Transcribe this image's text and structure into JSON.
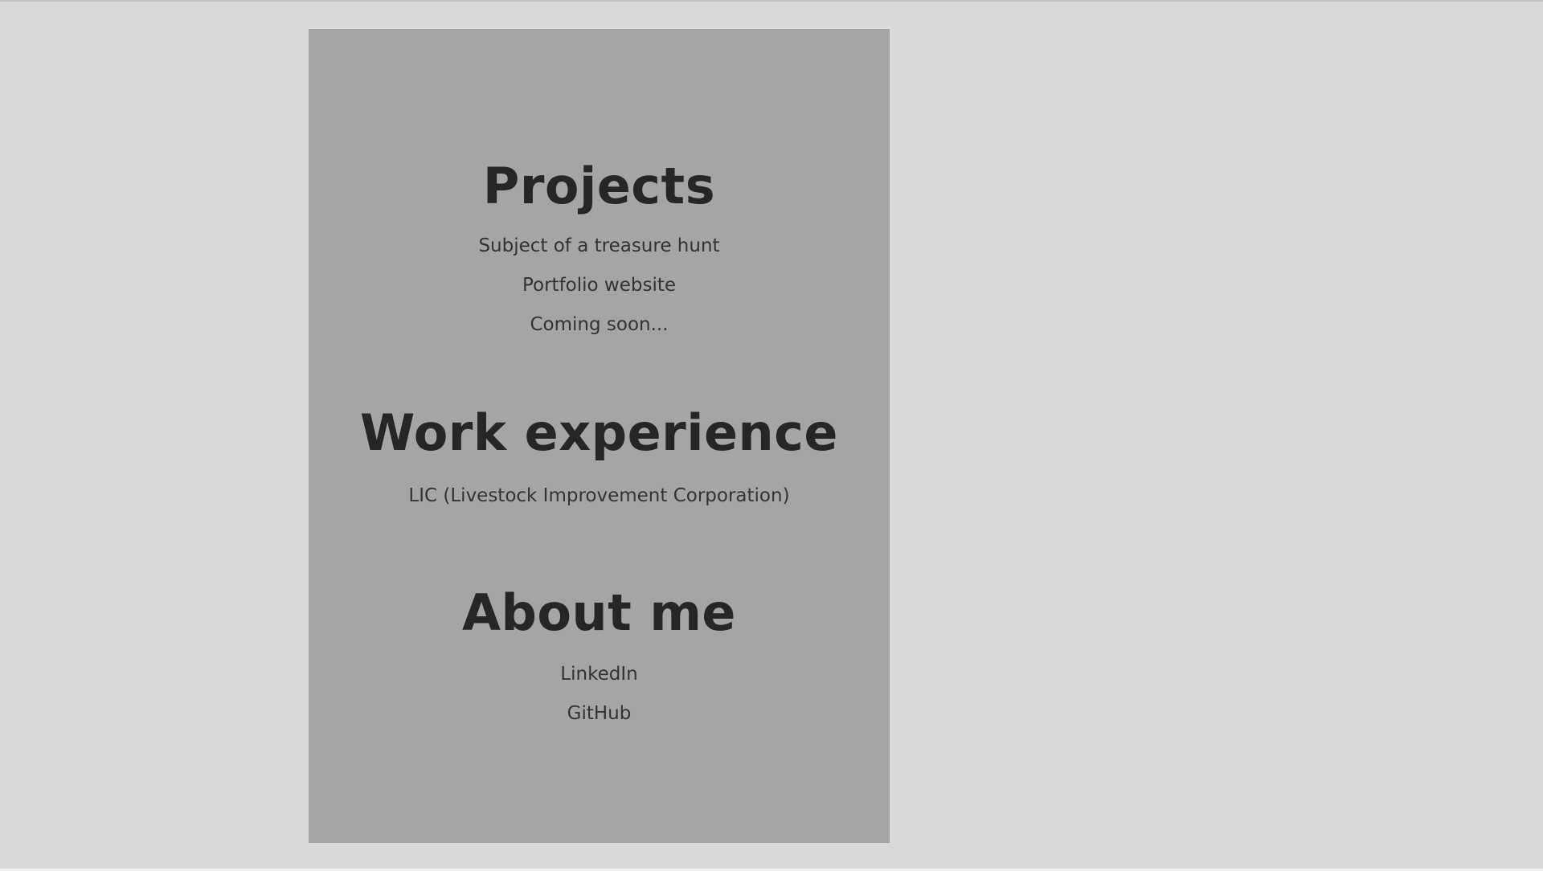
{
  "sections": {
    "projects": {
      "heading": "Projects",
      "items": [
        "Subject of a treasure hunt",
        "Portfolio website",
        "Coming soon..."
      ]
    },
    "work": {
      "heading": "Work experience",
      "items": [
        "LIC (Livestock Improvement Corporation)"
      ]
    },
    "about": {
      "heading": "About me",
      "items": [
        "LinkedIn",
        "GitHub"
      ]
    }
  },
  "colors": {
    "page_background": "#d9d9d9",
    "panel_background": "#a5a5a5",
    "heading_text": "#262626",
    "link_text": "#333333"
  }
}
